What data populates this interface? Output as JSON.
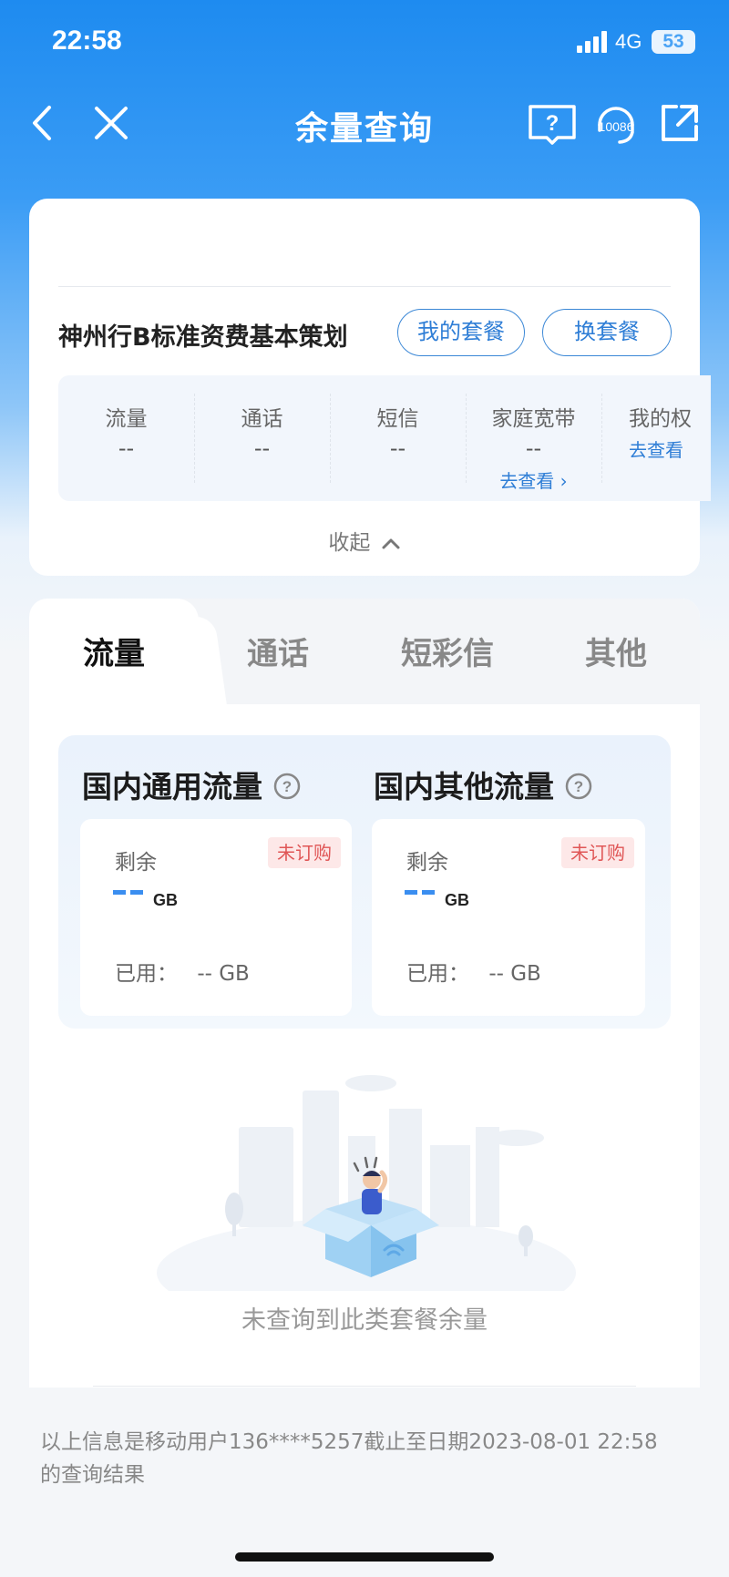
{
  "status": {
    "time": "22:58",
    "network": "4G",
    "battery": "53"
  },
  "nav": {
    "title": "余量查询",
    "service_number": "10086"
  },
  "package": {
    "name": "神州行B标准资费基本策划",
    "my_plan_label": "我的套餐",
    "change_plan_label": "换套餐",
    "stats": [
      {
        "label": "流量",
        "value": "--"
      },
      {
        "label": "通话",
        "value": "--"
      },
      {
        "label": "短信",
        "value": "--"
      },
      {
        "label": "家庭宽带",
        "value": "--",
        "link": "去查看 ›"
      },
      {
        "label": "我的权",
        "link": "去查看"
      }
    ],
    "collapse_label": "收起"
  },
  "tabs": [
    {
      "label": "流量",
      "active": true
    },
    {
      "label": "通话",
      "active": false
    },
    {
      "label": "短彩信",
      "active": false
    },
    {
      "label": "其他",
      "active": false
    }
  ],
  "flow": [
    {
      "title": "国内通用流量",
      "remain_label": "剩余",
      "badge": "未订购",
      "unit": "GB",
      "used_label": "已用：",
      "used_value": "-- GB"
    },
    {
      "title": "国内其他流量",
      "remain_label": "剩余",
      "badge": "未订购",
      "unit": "GB",
      "used_label": "已用：",
      "used_value": "-- GB"
    }
  ],
  "empty_text": "未查询到此类套餐余量",
  "footer_note": "以上信息是移动用户136****5257截止至日期2023-08-01 22:58的查询结果",
  "colors": {
    "primary": "#1e8bf0",
    "link": "#2f7ed6",
    "badge_bg": "#fde8e8",
    "badge_text": "#e05656"
  }
}
